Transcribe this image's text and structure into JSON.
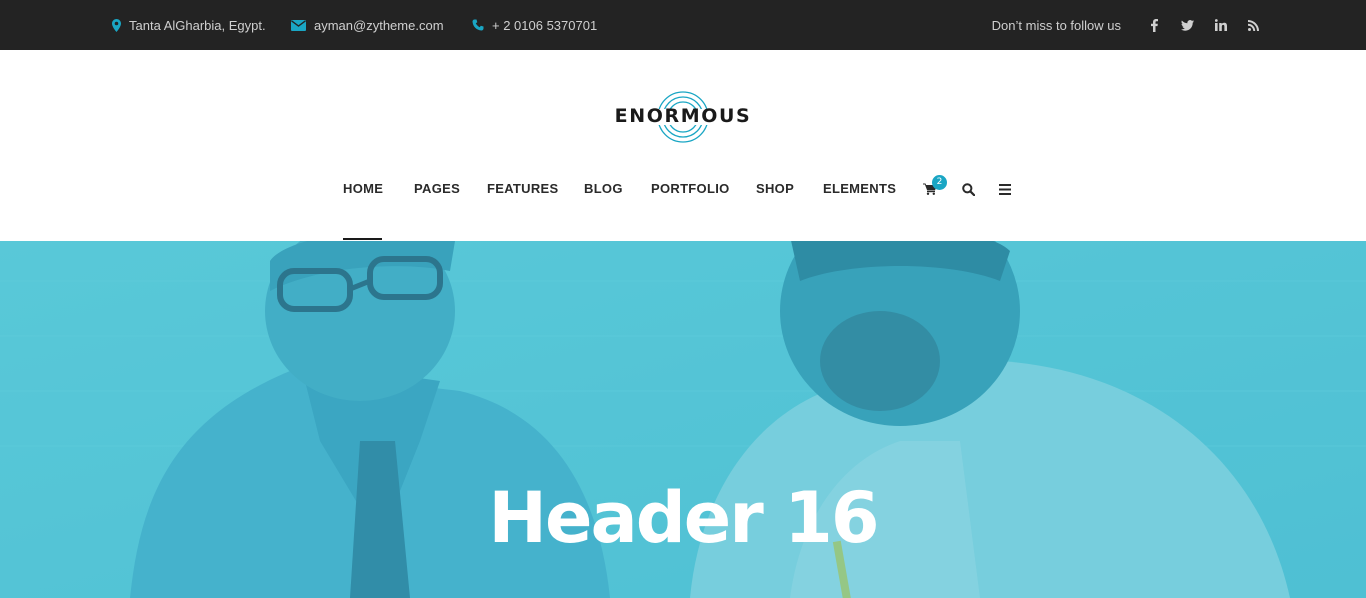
{
  "topbar": {
    "location": "Tanta AlGharbia, Egypt.",
    "email": "ayman@zytheme.com",
    "phone": "+ 2 0106 5370701",
    "follow_text": "Don’t miss to follow us",
    "icons": [
      "map-marker-icon",
      "envelope-icon",
      "phone-icon",
      "facebook-icon",
      "twitter-icon",
      "linkedin-icon",
      "rss-icon"
    ]
  },
  "brand": {
    "name": "ENORMOUS",
    "accent_color": "#1aa6c4"
  },
  "nav": {
    "items": [
      "HOME",
      "PAGES",
      "FEATURES",
      "BLOG",
      "PORTFOLIO",
      "SHOP",
      "ELEMENTS"
    ],
    "active": "HOME",
    "cart_count": "2",
    "icons": [
      "cart-icon",
      "search-icon",
      "menu-icon"
    ]
  },
  "hero": {
    "title": "Header 16",
    "overlay_color": "#53c5d8"
  }
}
